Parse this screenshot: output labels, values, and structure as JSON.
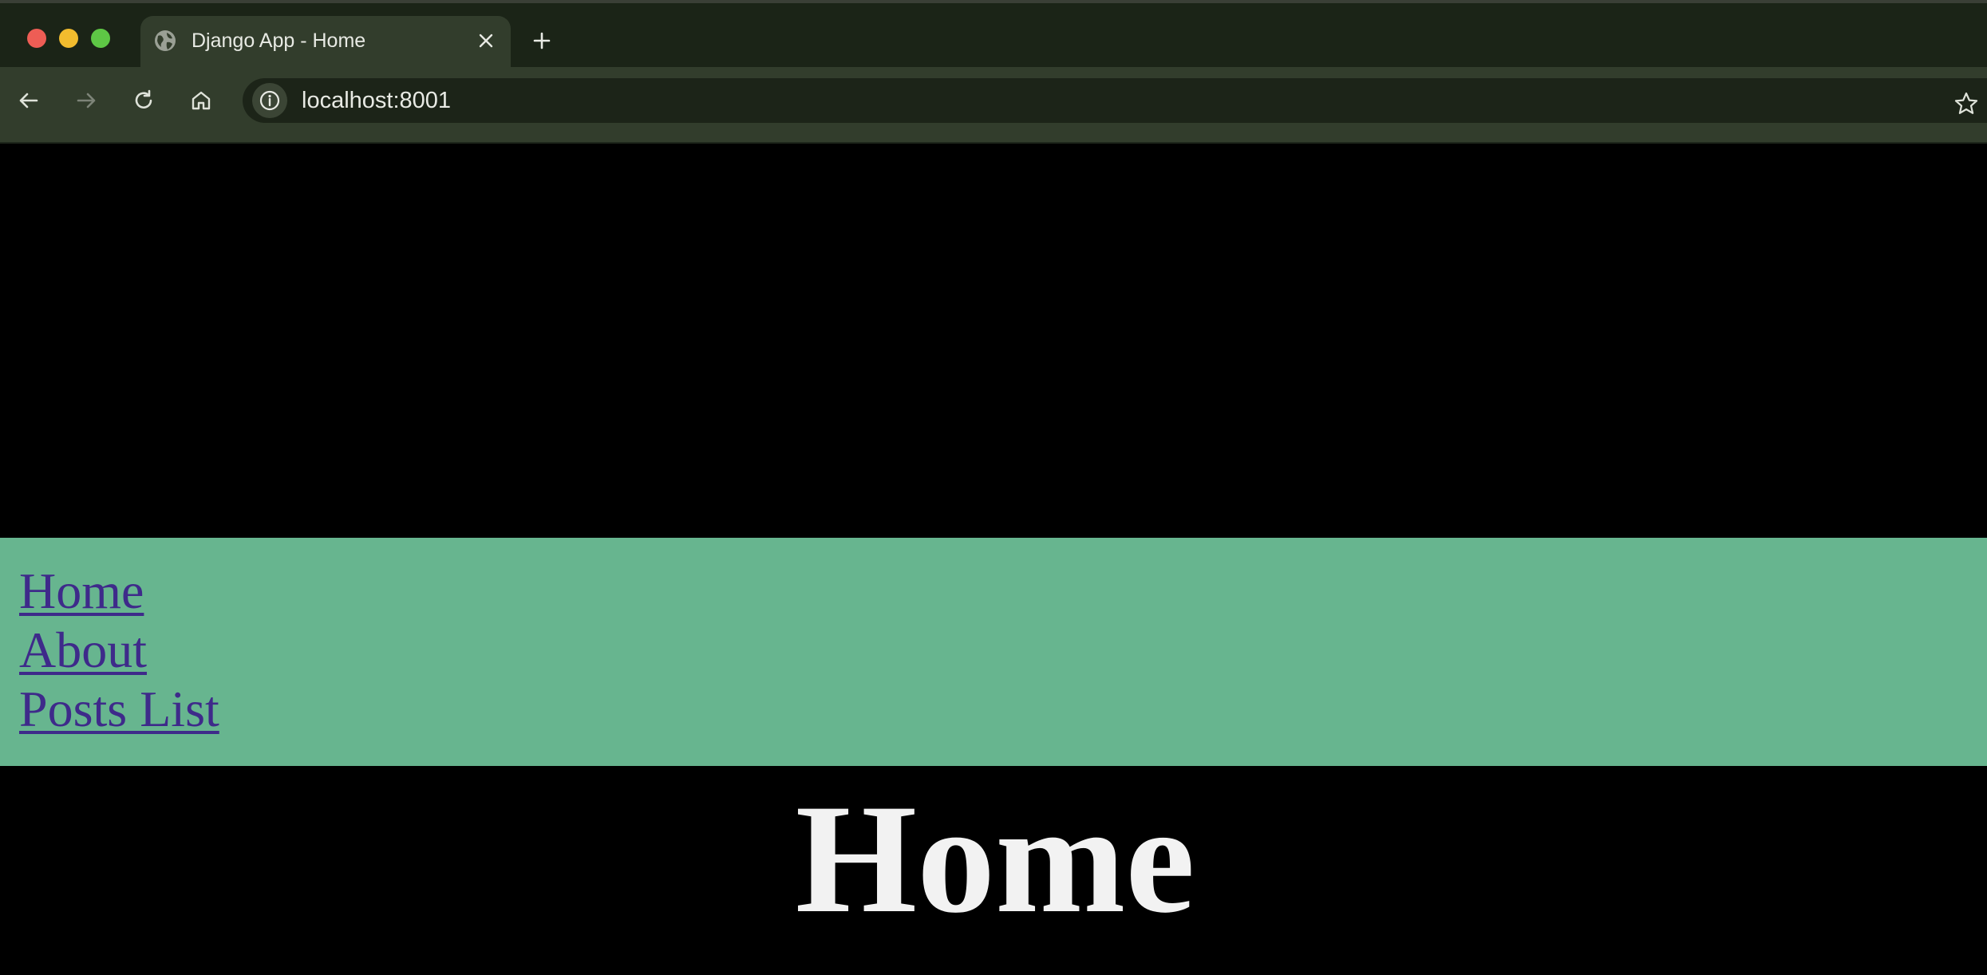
{
  "window": {
    "controls": [
      "close",
      "minimize",
      "zoom"
    ]
  },
  "tab": {
    "title": "Django App - Home",
    "favicon": "globe-icon"
  },
  "toolbar": {
    "url": "localhost:8001"
  },
  "page": {
    "nav_links": [
      {
        "label": "Home"
      },
      {
        "label": "About"
      },
      {
        "label": "Posts List"
      }
    ],
    "heading": "Home",
    "colors": {
      "background": "#000000",
      "navbar": "#67b58f",
      "link": "#3e2a8a",
      "heading": "#f2f2f2"
    }
  }
}
